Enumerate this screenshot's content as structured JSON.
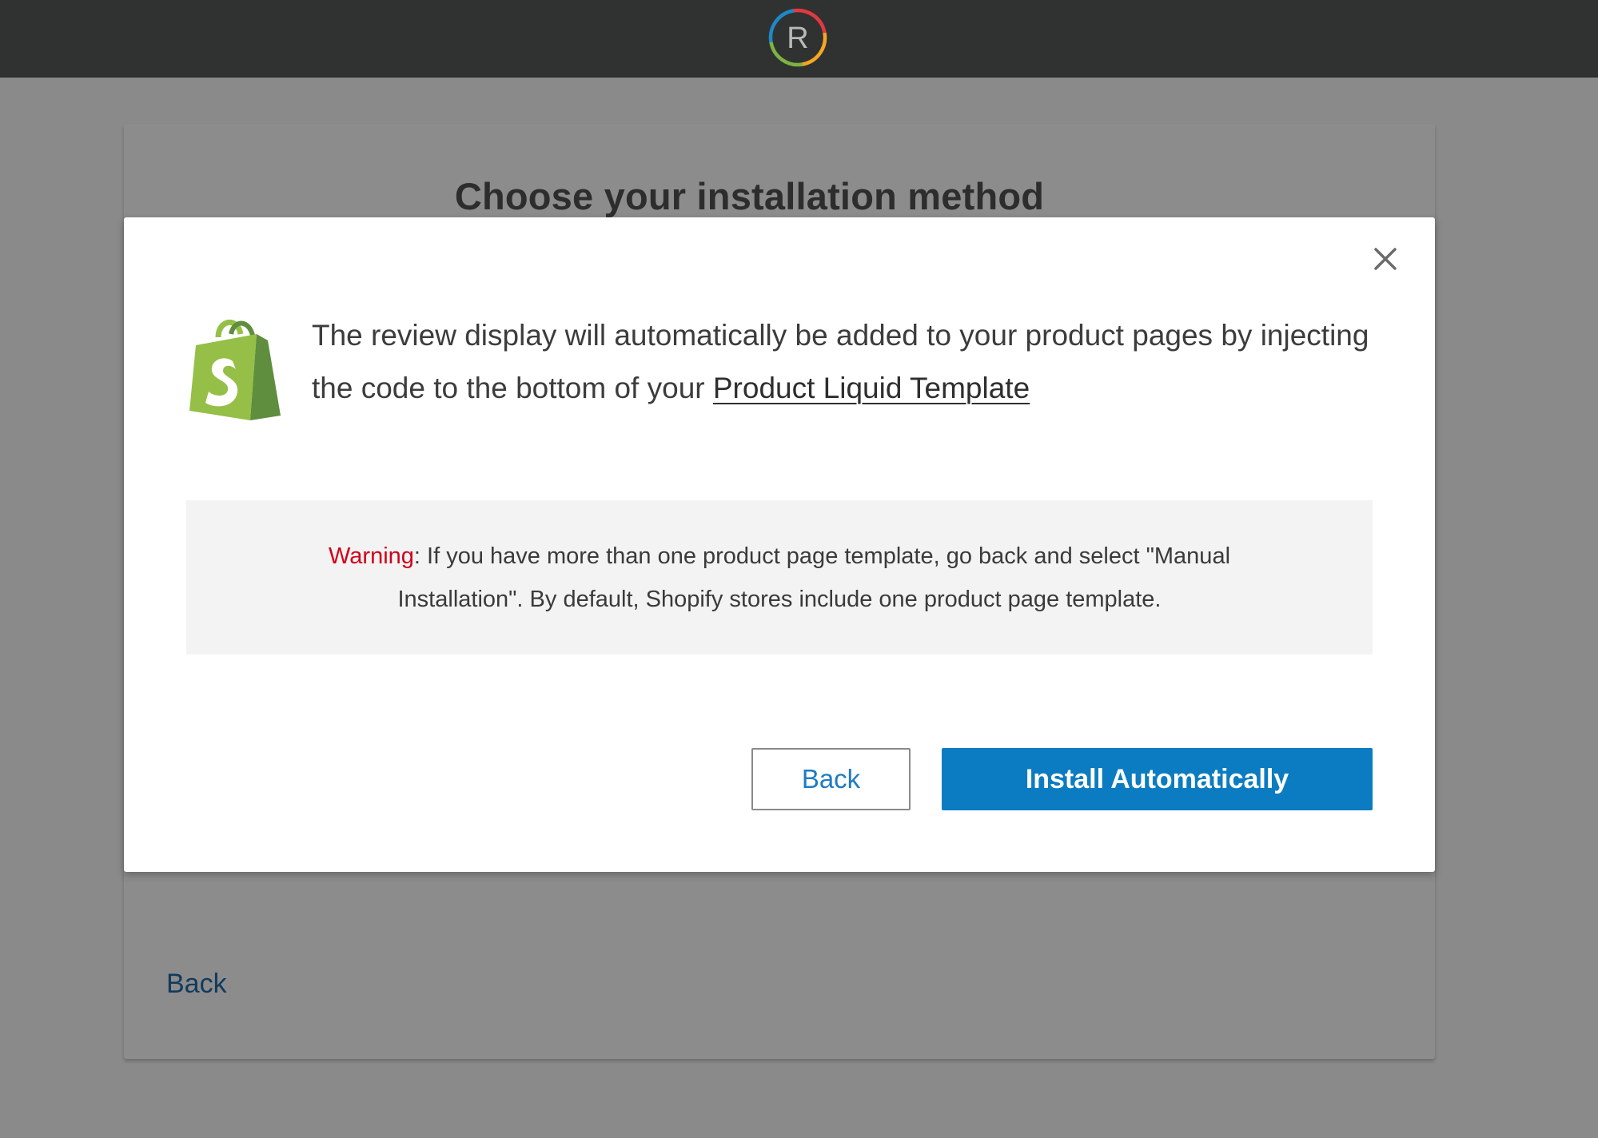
{
  "header": {
    "logo_letter": "R",
    "logo_icon": "brand-r-ring-logo"
  },
  "background_page": {
    "title": "Choose your installation method",
    "back_link": "Back"
  },
  "modal": {
    "close_icon": "close-x-icon",
    "shopify_icon": "shopify-bag-logo",
    "message_text": "The review display will automatically be added to your product pages by injecting the code to the bottom of your",
    "message_link": "Product Liquid Template",
    "warning_label": "Warning",
    "warning_text": ": If you have more than one product page template, go back and select \"Manual Installation\". By default, Shopify stores include one product page template.",
    "back_button": "Back",
    "install_button": "Install Automatically"
  },
  "colors": {
    "overlay_background": "#8a8a8a",
    "topbar": "#303232",
    "primary_button": "#0b7cc1",
    "warning_red": "#d0021b",
    "shopify_green_light": "#95bf47",
    "shopify_green_dark": "#5e8e3e"
  }
}
